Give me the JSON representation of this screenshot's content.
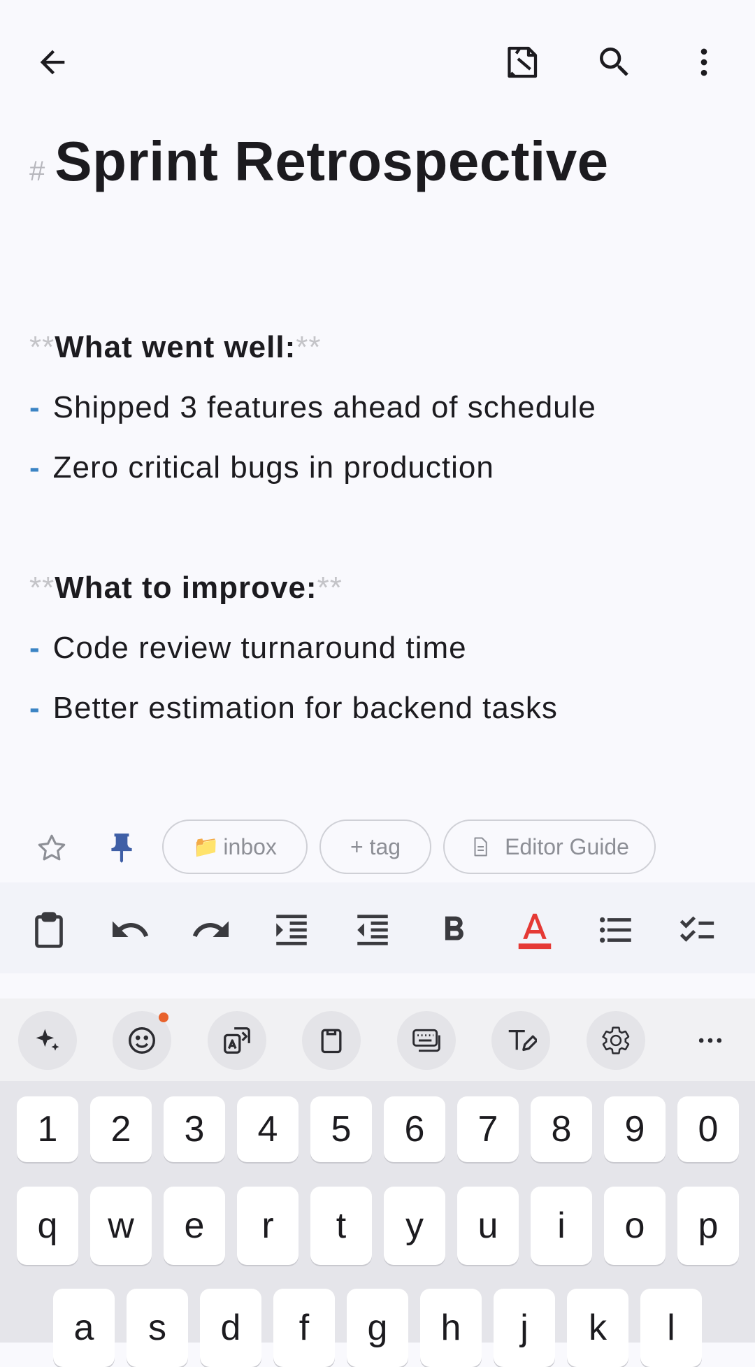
{
  "note": {
    "title_marker": "#",
    "title": "Sprint Retrospective",
    "sections": [
      {
        "md_open": "**",
        "heading": "What went well:",
        "md_close": "**",
        "bullets": [
          "Shipped 3 features ahead of schedule",
          "Zero critical bugs in production"
        ]
      },
      {
        "md_open": "**",
        "heading": "What to improve:",
        "md_close": "**",
        "bullets": [
          "Code review turnaround time",
          "Better estimation for backend tasks"
        ]
      }
    ],
    "bullet_marker": "-"
  },
  "meta": {
    "folder_emoji": "📁",
    "folder": "inbox",
    "add_tag": "+ tag",
    "editor_guide": "Editor Guide"
  },
  "colors": {
    "accent_blue": "#3b84c4",
    "pin_blue": "#3f5fa6",
    "text_color_red": "#e53935",
    "notification_dot": "#e8622c"
  },
  "keyboard": {
    "numbers": [
      "1",
      "2",
      "3",
      "4",
      "5",
      "6",
      "7",
      "8",
      "9",
      "0"
    ],
    "row1": [
      "q",
      "w",
      "e",
      "r",
      "t",
      "y",
      "u",
      "i",
      "o",
      "p"
    ],
    "row2": [
      "a",
      "s",
      "d",
      "f",
      "g",
      "h",
      "j",
      "k",
      "l"
    ]
  }
}
